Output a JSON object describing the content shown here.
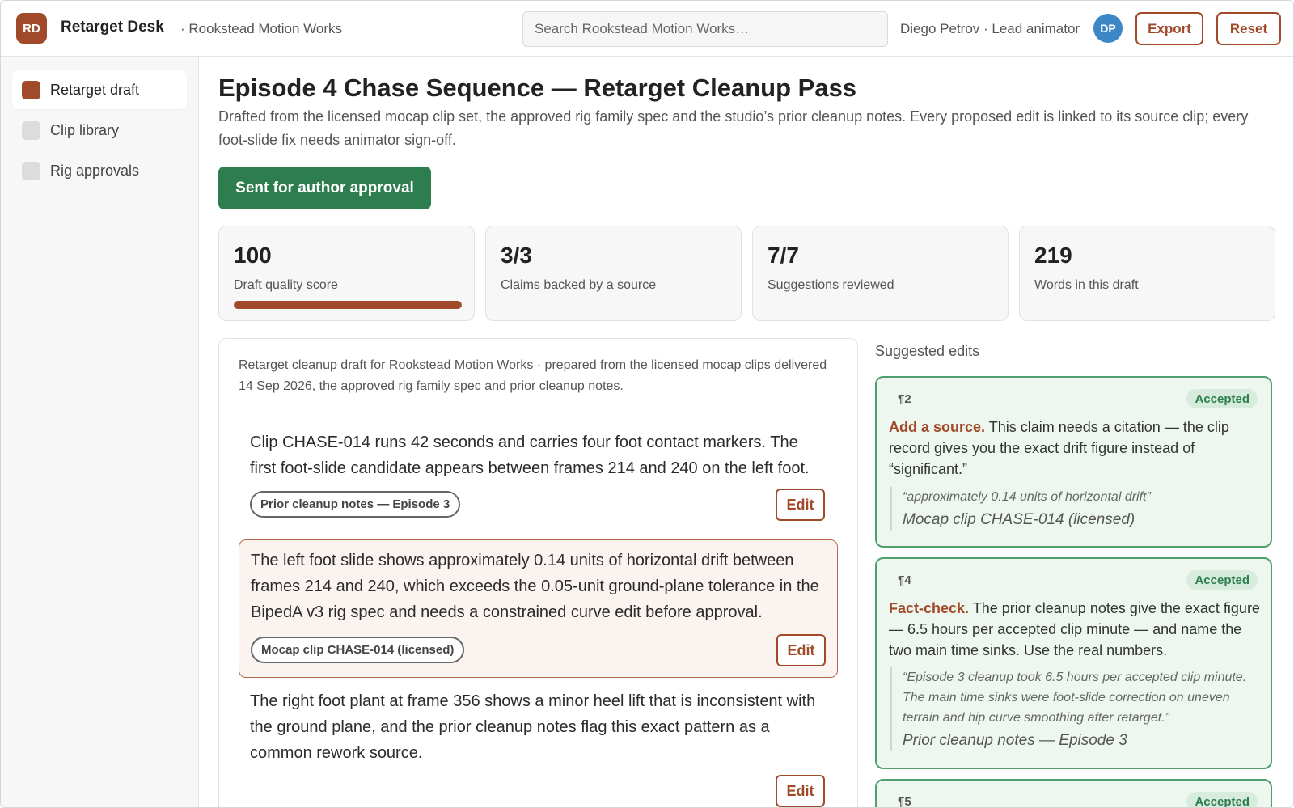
{
  "header": {
    "logo_initials": "RD",
    "app_title": "Retarget Desk",
    "org_name": "· Rookstead Motion Works",
    "search_placeholder": "Search Rookstead Motion Works…",
    "user_name": "Diego Petrov · Lead animator",
    "user_initials": "DP",
    "export_label": "Export",
    "reset_label": "Reset"
  },
  "sidebar": {
    "items": [
      {
        "label": "Retarget draft",
        "active": true
      },
      {
        "label": "Clip library",
        "active": false
      },
      {
        "label": "Rig approvals",
        "active": false
      }
    ]
  },
  "main": {
    "title": "Episode 4 Chase Sequence — Retarget Cleanup Pass",
    "description": "Drafted from the licensed mocap clip set, the approved rig family spec and the studio’s prior cleanup notes. Every proposed edit is linked to its source clip; every foot-slide fix needs animator sign-off.",
    "status_label": "Sent for author approval",
    "stats": [
      {
        "value": "100",
        "label": "Draft quality score",
        "progress": 1.0
      },
      {
        "value": "3/3",
        "label": "Claims backed by a source"
      },
      {
        "value": "7/7",
        "label": "Suggestions reviewed"
      },
      {
        "value": "219",
        "label": "Words in this draft"
      }
    ],
    "draft": {
      "intro": "Retarget cleanup draft for Rookstead Motion Works · prepared from the licensed mocap clips delivered 14 Sep 2026, the approved rig family spec and prior cleanup notes.",
      "paragraphs": [
        {
          "text": "Clip CHASE-014 runs 42 seconds and carries four foot contact markers. The first foot-slide candidate appears between frames 214 and 240 on the left foot.",
          "source": "Prior cleanup notes — Episode 3",
          "edit_label": "Edit"
        },
        {
          "text": "The left foot slide shows approximately 0.14 units of horizontal drift between frames 214 and 240, which exceeds the 0.05-unit ground-plane tolerance in the BipedA v3 rig spec and needs a constrained curve edit before approval.",
          "source": "Mocap clip CHASE-014 (licensed)",
          "edit_label": "Edit"
        },
        {
          "text": "The right foot plant at frame 356 shows a minor heel lift that is inconsistent with the ground plane, and the prior cleanup notes flag this exact pattern as a common rework source.",
          "edit_label": "Edit"
        }
      ]
    },
    "suggestions": {
      "heading": "Suggested edits",
      "items": [
        {
          "para": "¶2",
          "status": "Accepted",
          "kind": "Add a source.",
          "body": "This claim needs a citation — the clip record gives you the exact drift figure instead of “significant.”",
          "quote": "“approximately 0.14 units of horizontal drift”",
          "source": "Mocap clip CHASE-014 (licensed)"
        },
        {
          "para": "¶4",
          "status": "Accepted",
          "kind": "Fact-check.",
          "body": "The prior cleanup notes give the exact figure — 6.5 hours per accepted clip minute — and name the two main time sinks. Use the real numbers.",
          "quote": "“Episode 3 cleanup took 6.5 hours per accepted clip minute. The main time sinks were foot-slide correction on uneven terrain and hip curve smoothing after retarget.”",
          "source": "Prior cleanup notes — Episode 3"
        },
        {
          "para": "¶5",
          "status": "Accepted"
        }
      ]
    }
  },
  "colors": {
    "accent": "#a04a29",
    "success": "#2e7d4f",
    "avatar": "#3e87c6"
  }
}
